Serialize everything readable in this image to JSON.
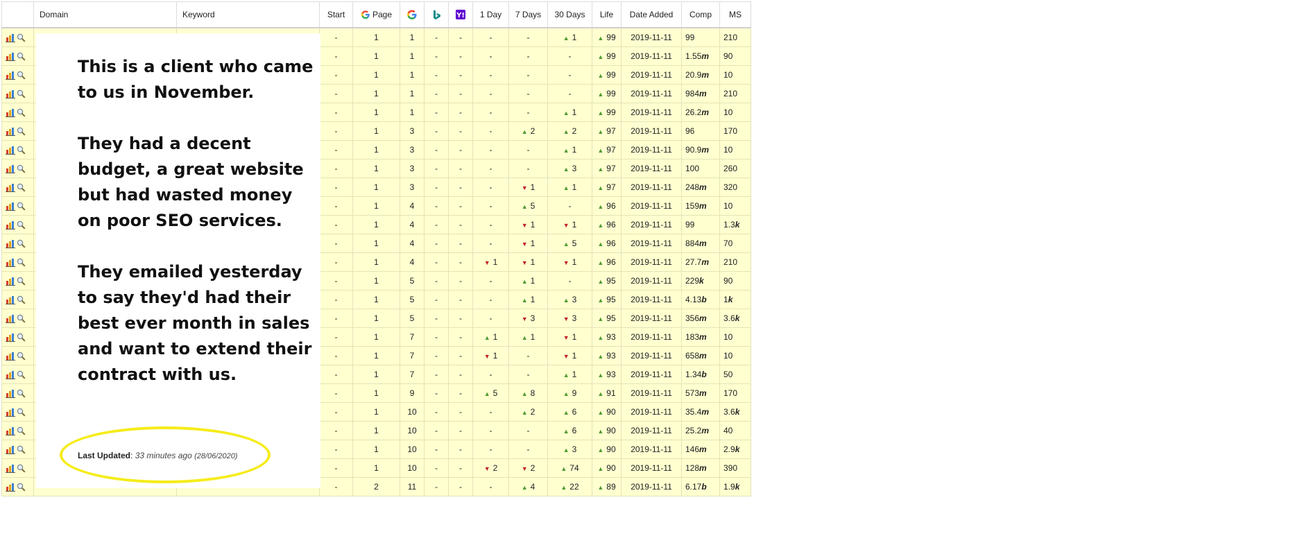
{
  "columns": {
    "domain": "Domain",
    "keyword": "Keyword",
    "start": "Start",
    "page": "Page",
    "one_day": "1 Day",
    "seven_days": "7 Days",
    "thirty_days": "30 Days",
    "life": "Life",
    "date_added": "Date Added",
    "comp": "Comp",
    "ms": "MS"
  },
  "engine_icons": [
    "google-icon",
    "bing-icon",
    "yahoo-icon"
  ],
  "colors": {
    "row_bg": "#ffffd0",
    "up": "#4e9a2e",
    "down": "#c0212b",
    "highlight": "#f5ec1a"
  },
  "rows": [
    {
      "start": "-",
      "page": "1",
      "google": "1",
      "bing": "-",
      "yahoo": "-",
      "d1": "-",
      "d1_dir": "",
      "d7": "-",
      "d7_dir": "",
      "d30": "1",
      "d30_dir": "up",
      "life": "99",
      "date": "2019-11-11",
      "comp": "99",
      "comp_unit": "",
      "ms": "210",
      "ms_unit": ""
    },
    {
      "start": "-",
      "page": "1",
      "google": "1",
      "bing": "-",
      "yahoo": "-",
      "d1": "-",
      "d1_dir": "",
      "d7": "-",
      "d7_dir": "",
      "d30": "-",
      "d30_dir": "",
      "life": "99",
      "date": "2019-11-11",
      "comp": "1.55",
      "comp_unit": "m",
      "ms": "90",
      "ms_unit": ""
    },
    {
      "start": "-",
      "page": "1",
      "google": "1",
      "bing": "-",
      "yahoo": "-",
      "d1": "-",
      "d1_dir": "",
      "d7": "-",
      "d7_dir": "",
      "d30": "-",
      "d30_dir": "",
      "life": "99",
      "date": "2019-11-11",
      "comp": "20.9",
      "comp_unit": "m",
      "ms": "10",
      "ms_unit": ""
    },
    {
      "start": "-",
      "page": "1",
      "google": "1",
      "bing": "-",
      "yahoo": "-",
      "d1": "-",
      "d1_dir": "",
      "d7": "-",
      "d7_dir": "",
      "d30": "-",
      "d30_dir": "",
      "life": "99",
      "date": "2019-11-11",
      "comp": "984",
      "comp_unit": "m",
      "ms": "210",
      "ms_unit": ""
    },
    {
      "start": "-",
      "page": "1",
      "google": "1",
      "bing": "-",
      "yahoo": "-",
      "d1": "-",
      "d1_dir": "",
      "d7": "-",
      "d7_dir": "",
      "d30": "1",
      "d30_dir": "up",
      "life": "99",
      "date": "2019-11-11",
      "comp": "26.2",
      "comp_unit": "m",
      "ms": "10",
      "ms_unit": ""
    },
    {
      "start": "-",
      "page": "1",
      "google": "3",
      "bing": "-",
      "yahoo": "-",
      "d1": "-",
      "d1_dir": "",
      "d7": "2",
      "d7_dir": "up",
      "d30": "2",
      "d30_dir": "up",
      "life": "97",
      "date": "2019-11-11",
      "comp": "96",
      "comp_unit": "",
      "ms": "170",
      "ms_unit": ""
    },
    {
      "start": "-",
      "page": "1",
      "google": "3",
      "bing": "-",
      "yahoo": "-",
      "d1": "-",
      "d1_dir": "",
      "d7": "-",
      "d7_dir": "",
      "d30": "1",
      "d30_dir": "up",
      "life": "97",
      "date": "2019-11-11",
      "comp": "90.9",
      "comp_unit": "m",
      "ms": "10",
      "ms_unit": ""
    },
    {
      "start": "-",
      "page": "1",
      "google": "3",
      "bing": "-",
      "yahoo": "-",
      "d1": "-",
      "d1_dir": "",
      "d7": "-",
      "d7_dir": "",
      "d30": "3",
      "d30_dir": "up",
      "life": "97",
      "date": "2019-11-11",
      "comp": "100",
      "comp_unit": "",
      "ms": "260",
      "ms_unit": ""
    },
    {
      "start": "-",
      "page": "1",
      "google": "3",
      "bing": "-",
      "yahoo": "-",
      "d1": "-",
      "d1_dir": "",
      "d7": "1",
      "d7_dir": "down",
      "d30": "1",
      "d30_dir": "up",
      "life": "97",
      "date": "2019-11-11",
      "comp": "248",
      "comp_unit": "m",
      "ms": "320",
      "ms_unit": ""
    },
    {
      "start": "-",
      "page": "1",
      "google": "4",
      "bing": "-",
      "yahoo": "-",
      "d1": "-",
      "d1_dir": "",
      "d7": "5",
      "d7_dir": "up",
      "d30": "-",
      "d30_dir": "",
      "life": "96",
      "date": "2019-11-11",
      "comp": "159",
      "comp_unit": "m",
      "ms": "10",
      "ms_unit": ""
    },
    {
      "start": "-",
      "page": "1",
      "google": "4",
      "bing": "-",
      "yahoo": "-",
      "d1": "-",
      "d1_dir": "",
      "d7": "1",
      "d7_dir": "down",
      "d30": "1",
      "d30_dir": "down",
      "life": "96",
      "date": "2019-11-11",
      "comp": "99",
      "comp_unit": "",
      "ms": "1.3",
      "ms_unit": "k"
    },
    {
      "start": "-",
      "page": "1",
      "google": "4",
      "bing": "-",
      "yahoo": "-",
      "d1": "-",
      "d1_dir": "",
      "d7": "1",
      "d7_dir": "down",
      "d30": "5",
      "d30_dir": "up",
      "life": "96",
      "date": "2019-11-11",
      "comp": "884",
      "comp_unit": "m",
      "ms": "70",
      "ms_unit": ""
    },
    {
      "start": "-",
      "page": "1",
      "google": "4",
      "bing": "-",
      "yahoo": "-",
      "d1": "1",
      "d1_dir": "down",
      "d7": "1",
      "d7_dir": "down",
      "d30": "1",
      "d30_dir": "down",
      "life": "96",
      "date": "2019-11-11",
      "comp": "27.7",
      "comp_unit": "m",
      "ms": "210",
      "ms_unit": ""
    },
    {
      "start": "-",
      "page": "1",
      "google": "5",
      "bing": "-",
      "yahoo": "-",
      "d1": "-",
      "d1_dir": "",
      "d7": "1",
      "d7_dir": "up",
      "d30": "-",
      "d30_dir": "",
      "life": "95",
      "date": "2019-11-11",
      "comp": "229",
      "comp_unit": "k",
      "ms": "90",
      "ms_unit": ""
    },
    {
      "start": "-",
      "page": "1",
      "google": "5",
      "bing": "-",
      "yahoo": "-",
      "d1": "-",
      "d1_dir": "",
      "d7": "1",
      "d7_dir": "up",
      "d30": "3",
      "d30_dir": "up",
      "life": "95",
      "date": "2019-11-11",
      "comp": "4.13",
      "comp_unit": "b",
      "ms": "1",
      "ms_unit": "k"
    },
    {
      "start": "-",
      "page": "1",
      "google": "5",
      "bing": "-",
      "yahoo": "-",
      "d1": "-",
      "d1_dir": "",
      "d7": "3",
      "d7_dir": "down",
      "d30": "3",
      "d30_dir": "down",
      "life": "95",
      "date": "2019-11-11",
      "comp": "356",
      "comp_unit": "m",
      "ms": "3.6",
      "ms_unit": "k"
    },
    {
      "start": "-",
      "page": "1",
      "google": "7",
      "bing": "-",
      "yahoo": "-",
      "d1": "1",
      "d1_dir": "up",
      "d7": "1",
      "d7_dir": "up",
      "d30": "1",
      "d30_dir": "down",
      "life": "93",
      "date": "2019-11-11",
      "comp": "183",
      "comp_unit": "m",
      "ms": "10",
      "ms_unit": ""
    },
    {
      "start": "-",
      "page": "1",
      "google": "7",
      "bing": "-",
      "yahoo": "-",
      "d1": "1",
      "d1_dir": "down",
      "d7": "-",
      "d7_dir": "",
      "d30": "1",
      "d30_dir": "down",
      "life": "93",
      "date": "2019-11-11",
      "comp": "658",
      "comp_unit": "m",
      "ms": "10",
      "ms_unit": ""
    },
    {
      "start": "-",
      "page": "1",
      "google": "7",
      "bing": "-",
      "yahoo": "-",
      "d1": "-",
      "d1_dir": "",
      "d7": "-",
      "d7_dir": "",
      "d30": "1",
      "d30_dir": "up",
      "life": "93",
      "date": "2019-11-11",
      "comp": "1.34",
      "comp_unit": "b",
      "ms": "50",
      "ms_unit": ""
    },
    {
      "start": "-",
      "page": "1",
      "google": "9",
      "bing": "-",
      "yahoo": "-",
      "d1": "5",
      "d1_dir": "up",
      "d7": "8",
      "d7_dir": "up",
      "d30": "9",
      "d30_dir": "up",
      "life": "91",
      "date": "2019-11-11",
      "comp": "573",
      "comp_unit": "m",
      "ms": "170",
      "ms_unit": ""
    },
    {
      "start": "-",
      "page": "1",
      "google": "10",
      "bing": "-",
      "yahoo": "-",
      "d1": "-",
      "d1_dir": "",
      "d7": "2",
      "d7_dir": "up",
      "d30": "6",
      "d30_dir": "up",
      "life": "90",
      "date": "2019-11-11",
      "comp": "35.4",
      "comp_unit": "m",
      "ms": "3.6",
      "ms_unit": "k"
    },
    {
      "start": "-",
      "page": "1",
      "google": "10",
      "bing": "-",
      "yahoo": "-",
      "d1": "-",
      "d1_dir": "",
      "d7": "-",
      "d7_dir": "",
      "d30": "6",
      "d30_dir": "up",
      "life": "90",
      "date": "2019-11-11",
      "comp": "25.2",
      "comp_unit": "m",
      "ms": "40",
      "ms_unit": ""
    },
    {
      "start": "-",
      "page": "1",
      "google": "10",
      "bing": "-",
      "yahoo": "-",
      "d1": "-",
      "d1_dir": "",
      "d7": "-",
      "d7_dir": "",
      "d30": "3",
      "d30_dir": "up",
      "life": "90",
      "date": "2019-11-11",
      "comp": "146",
      "comp_unit": "m",
      "ms": "2.9",
      "ms_unit": "k"
    },
    {
      "start": "-",
      "page": "1",
      "google": "10",
      "bing": "-",
      "yahoo": "-",
      "d1": "2",
      "d1_dir": "down",
      "d7": "2",
      "d7_dir": "down",
      "d30": "74",
      "d30_dir": "up",
      "life": "90",
      "date": "2019-11-11",
      "comp": "128",
      "comp_unit": "m",
      "ms": "390",
      "ms_unit": ""
    },
    {
      "start": "-",
      "page": "2",
      "google": "11",
      "bing": "-",
      "yahoo": "-",
      "d1": "-",
      "d1_dir": "",
      "d7": "4",
      "d7_dir": "up",
      "d30": "22",
      "d30_dir": "up",
      "life": "89",
      "date": "2019-11-11",
      "comp": "6.17",
      "comp_unit": "b",
      "ms": "1.9",
      "ms_unit": "k"
    }
  ],
  "message": [
    "This is a client who came to us in November.",
    "They had a decent budget, a great website but had wasted money on poor SEO services.",
    "They emailed yesterday to say they'd had their best ever month in sales and want to extend their contract with us."
  ],
  "last_updated": {
    "label": "Last Updated",
    "ago": "33 minutes ago",
    "date": "(28/06/2020)"
  }
}
